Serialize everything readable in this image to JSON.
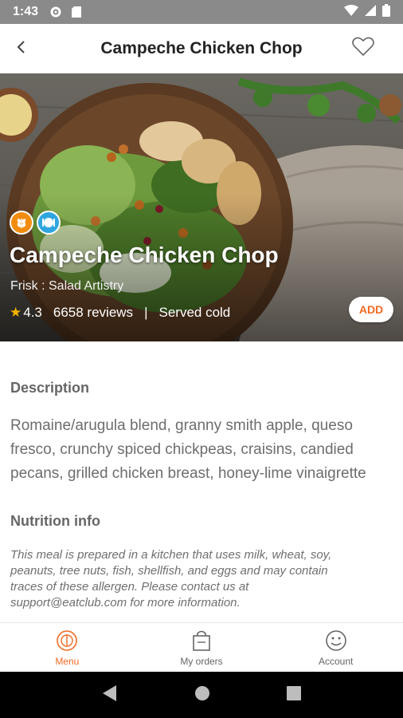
{
  "status_bar": {
    "time": "1:43",
    "icons": [
      "gear-icon",
      "sd-card-icon",
      "wifi-icon",
      "signal-icon",
      "battery-icon"
    ]
  },
  "header": {
    "title": "Campeche Chicken Chop",
    "back_icon": "back-arrow-icon",
    "favorite_icon": "heart-icon"
  },
  "hero": {
    "badges": [
      "wheat-badge-icon",
      "plate-badge-icon"
    ],
    "title": "Campeche Chicken Chop",
    "vendor": "Frisk : Salad Artistry",
    "rating": "4.3",
    "reviews": "6658 reviews",
    "separator": "|",
    "serving": "Served cold",
    "add_label": "ADD"
  },
  "details": {
    "description_heading": "Description",
    "description_text": "Romaine/arugula blend, granny smith apple, queso fresco, crunchy spiced chickpeas, craisins, candied pecans, grilled chicken breast, honey-lime vinaigrette",
    "nutrition_heading": "Nutrition info",
    "allergen_text": "This meal is prepared in a kitchen that uses milk, wheat, soy, peanuts, tree nuts, fish, shellfish, and eggs and may contain traces of these allergen. Please contact us at support@eatclub.com for more information."
  },
  "bottom_nav": {
    "items": [
      {
        "label": "Menu",
        "icon": "menu-icon",
        "active": true
      },
      {
        "label": "My orders",
        "icon": "orders-bag-icon",
        "active": false
      },
      {
        "label": "Account",
        "icon": "smiley-account-icon",
        "active": false
      }
    ]
  },
  "colors": {
    "accent": "#f26a24",
    "status_bar": "#8a8a8a",
    "star": "#f5b300"
  }
}
